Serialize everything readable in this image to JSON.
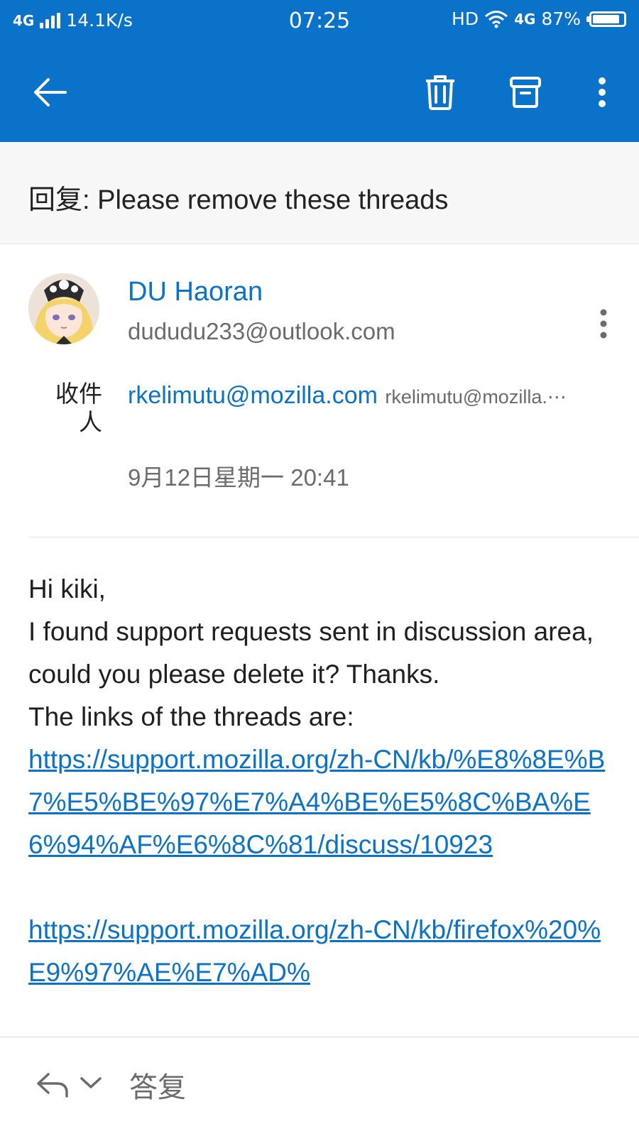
{
  "status_bar": {
    "network": "4G",
    "speed": "14.1K/s",
    "time": "07:25",
    "hd": "HD",
    "network2": "4G",
    "battery": "87%",
    "battery_level": 0.87
  },
  "toolbar": {
    "back_icon": "arrow-left-icon",
    "delete_icon": "trash-icon",
    "archive_icon": "archive-icon",
    "more_icon": "more-vertical-icon"
  },
  "message": {
    "subject": "回复: Please remove these threads",
    "sender": {
      "name": "DU Haoran",
      "email": "dududu233@outlook.com"
    },
    "to_label": "收件人",
    "to_name": "rkelimutu@mozilla.com",
    "to_address": "rkelimutu@mozilla.⋯",
    "date": "9月12日星期一 20:41",
    "body": {
      "greeting": "Hi kiki,",
      "line1": "I found support requests sent in discussion area, could you please delete it? Thanks.",
      "line2": "The links of the threads are:",
      "link1": "https://support.mozilla.org/zh-CN/kb/%E8%8E%B7%E5%BE%97%E7%A4%BE%E5%8C%BA%E6%94%AF%E6%8C%81/discuss/10923",
      "link2": "https://support.mozilla.org/zh-CN/kb/firefox%20%E9%97%AE%E7%AD%"
    }
  },
  "bottom_bar": {
    "reply_label": "答复"
  },
  "colors": {
    "accent": "#0b72c9",
    "subject_bg": "#f7f7f7",
    "secondary_text": "#6b6b6b"
  }
}
